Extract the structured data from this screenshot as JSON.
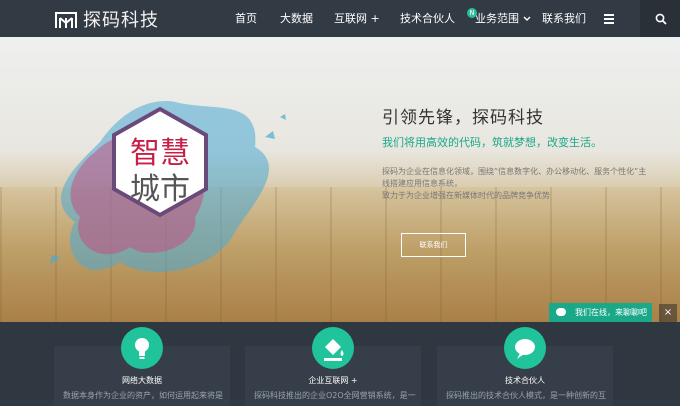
{
  "header": {
    "logo_text": "探码科技",
    "nav": [
      "首页",
      "大数据",
      "互联网 +",
      "技术合伙人",
      "业务范围",
      "联系我们"
    ],
    "badge": "N"
  },
  "hero": {
    "title": "引领先锋，探码科技",
    "subtitle": "我们将用高效的代码，筑就梦想，改变生活。",
    "desc_line1": "探码为企业在信息化领域，围绕“信息数字化、办公移动化、服务个性化”主线搭建应用信息系统，",
    "desc_line2": "致力于为企业增强在新媒体时代的品牌竞争优势",
    "button": "联系我们",
    "badge_text": [
      "智慧",
      "城市"
    ]
  },
  "chat": {
    "label": "我们在线，来聊聊吧",
    "close": "×"
  },
  "features": [
    {
      "title": "网络大数据",
      "text": "数据本身作为企业的资产，如何运用起来将是"
    },
    {
      "title": "企业互联网 +",
      "text": "探码科技推出的企业O2O全网营销系统，是一"
    },
    {
      "title": "技术合伙人",
      "text": "探码推出的技术合伙人模式，是一种创新的互"
    }
  ],
  "colors": {
    "accent": "#1aa889",
    "header_bg": "#323a44"
  }
}
